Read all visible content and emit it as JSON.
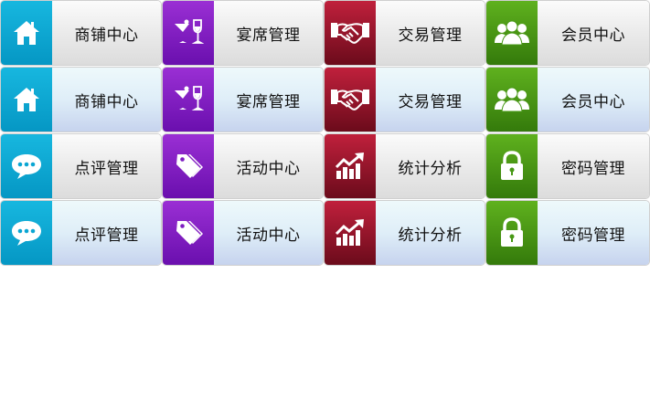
{
  "rows": [
    {
      "style": "plain",
      "tiles": [
        {
          "label": "商铺中心",
          "icon": "home-icon",
          "color": "#0aa6d3"
        },
        {
          "label": "宴席管理",
          "icon": "cocktail-wine-glasses-icon",
          "color": "#7e1cc2"
        },
        {
          "label": "交易管理",
          "icon": "handshake-icon",
          "color": "#951530"
        },
        {
          "label": "会员中心",
          "icon": "users-group-icon",
          "color": "#479815"
        }
      ]
    },
    {
      "style": "light",
      "tiles": [
        {
          "label": "商铺中心",
          "icon": "home-icon",
          "color": "#0aa6d3"
        },
        {
          "label": "宴席管理",
          "icon": "cocktail-wine-glasses-icon",
          "color": "#7e1cc2"
        },
        {
          "label": "交易管理",
          "icon": "handshake-icon",
          "color": "#951530"
        },
        {
          "label": "会员中心",
          "icon": "users-group-icon",
          "color": "#479815"
        }
      ]
    },
    {
      "style": "plain",
      "tiles": [
        {
          "label": "点评管理",
          "icon": "speech-bubble-icon",
          "color": "#0aa6d3"
        },
        {
          "label": "活动中心",
          "icon": "price-tags-icon",
          "color": "#7e1cc2"
        },
        {
          "label": "统计分析",
          "icon": "bar-chart-trend-icon",
          "color": "#951530"
        },
        {
          "label": "密码管理",
          "icon": "padlock-icon",
          "color": "#479815"
        }
      ]
    },
    {
      "style": "light",
      "tiles": [
        {
          "label": "点评管理",
          "icon": "speech-bubble-icon",
          "color": "#0aa6d3"
        },
        {
          "label": "活动中心",
          "icon": "price-tags-icon",
          "color": "#7e1cc2"
        },
        {
          "label": "统计分析",
          "icon": "bar-chart-trend-icon",
          "color": "#951530"
        },
        {
          "label": "密码管理",
          "icon": "padlock-icon",
          "color": "#479815"
        }
      ]
    }
  ]
}
